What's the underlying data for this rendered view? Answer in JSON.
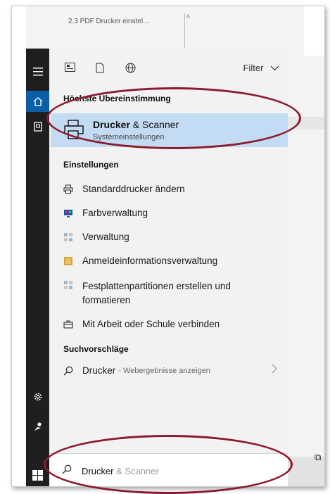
{
  "background": {
    "doc_title": "2.3 PDF Drucker einstel...",
    "scroll_marks": [
      "Ą",
      "·",
      "·",
      "·",
      "·"
    ]
  },
  "toolbar": {
    "filter_label": "Filter",
    "icons": [
      "app-tile-icon",
      "document-icon",
      "globe-icon"
    ]
  },
  "sections": {
    "best_match": "Höchste Übereinstimmung",
    "settings": "Einstellungen",
    "suggestions": "Suchvorschläge"
  },
  "best_match": {
    "title_bold": "Drucker",
    "title_rest": " & Scanner",
    "subtitle": "Systemeinstellungen"
  },
  "settings_items": [
    {
      "label": "Standarddrucker ändern",
      "icon": "printer-small-icon"
    },
    {
      "label": "Farbverwaltung",
      "icon": "color-monitor-icon"
    },
    {
      "label": "Verwaltung",
      "icon": "admin-tools-icon"
    },
    {
      "label": "Anmeldeinformationsverwaltung",
      "icon": "credential-vault-icon"
    },
    {
      "label": "Festplattenpartitionen erstellen und",
      "label2": "formatieren",
      "icon": "disk-partition-icon"
    },
    {
      "label": "Mit Arbeit oder Schule verbinden",
      "icon": "briefcase-icon"
    }
  ],
  "suggestion": {
    "term": "Drucker",
    "hint": "- Webergebnisse anzeigen"
  },
  "search": {
    "typed": "Drucker",
    "completion": " & Scanner"
  },
  "colors": {
    "accent": "#0a5fa6",
    "selection": "#c3dbf3",
    "annotation": "#8b1a2e",
    "rail": "#1f1f1f"
  }
}
